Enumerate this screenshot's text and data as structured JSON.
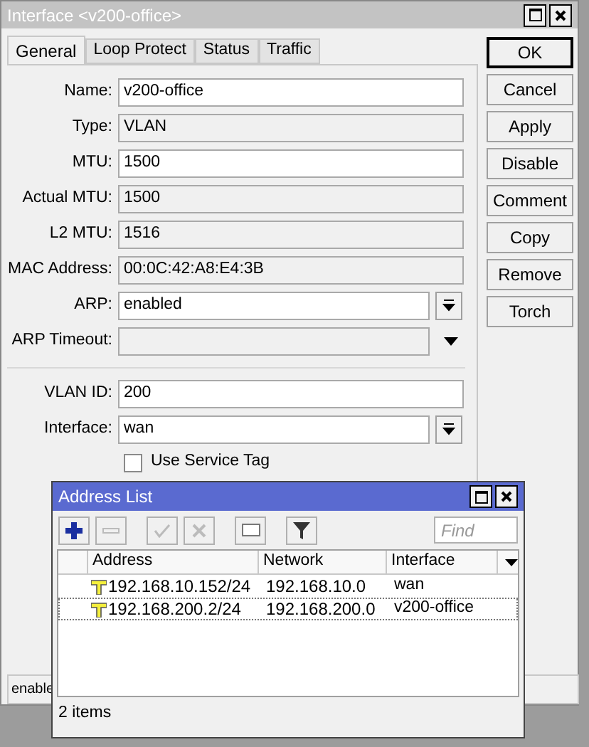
{
  "window": {
    "title": "Interface <v200-office>"
  },
  "tabs": [
    {
      "label": "General",
      "selected": true
    },
    {
      "label": "Loop Protect",
      "selected": false
    },
    {
      "label": "Status",
      "selected": false
    },
    {
      "label": "Traffic",
      "selected": false
    }
  ],
  "fields": [
    {
      "label": "Name:",
      "kind": "input",
      "value": "v200-office"
    },
    {
      "label": "Type:",
      "kind": "readonly",
      "value": "VLAN"
    },
    {
      "label": "MTU:",
      "kind": "input",
      "value": "1500"
    },
    {
      "label": "Actual MTU:",
      "kind": "readonly",
      "value": "1500"
    },
    {
      "label": "L2 MTU:",
      "kind": "readonly",
      "value": "1516"
    },
    {
      "label": "MAC Address:",
      "kind": "readonly",
      "value": "00:0C:42:A8:E4:3B"
    },
    {
      "label": "ARP:",
      "kind": "select",
      "value": "enabled"
    },
    {
      "label": "ARP Timeout:",
      "kind": "combo"
    },
    {
      "kind": "divider"
    },
    {
      "label": "VLAN ID:",
      "kind": "input",
      "value": "200"
    },
    {
      "label": "Interface:",
      "kind": "select",
      "value": "wan"
    },
    {
      "label": "Use Service Tag",
      "kind": "checkbox",
      "checked": false
    }
  ],
  "buttons": [
    {
      "label": "OK",
      "default": true
    },
    {
      "label": "Cancel",
      "default": false
    },
    {
      "label": "Apply",
      "default": false
    },
    {
      "label": "Disable",
      "default": false
    },
    {
      "label": "Comment",
      "default": false
    },
    {
      "label": "Copy",
      "default": false
    },
    {
      "label": "Remove",
      "default": false
    },
    {
      "label": "Torch",
      "default": false
    }
  ],
  "status_bar": "enable",
  "address_list": {
    "title": "Address List",
    "find_placeholder": "Find",
    "columns": [
      "Address",
      "Network",
      "Interface"
    ],
    "rows": [
      {
        "address": "192.168.10.152/24",
        "network": "192.168.10.0",
        "interface": "wan",
        "selected": false
      },
      {
        "address": "192.168.200.2/24",
        "network": "192.168.200.0",
        "interface": "v200-office",
        "selected": true
      }
    ],
    "footer": "2 items"
  }
}
